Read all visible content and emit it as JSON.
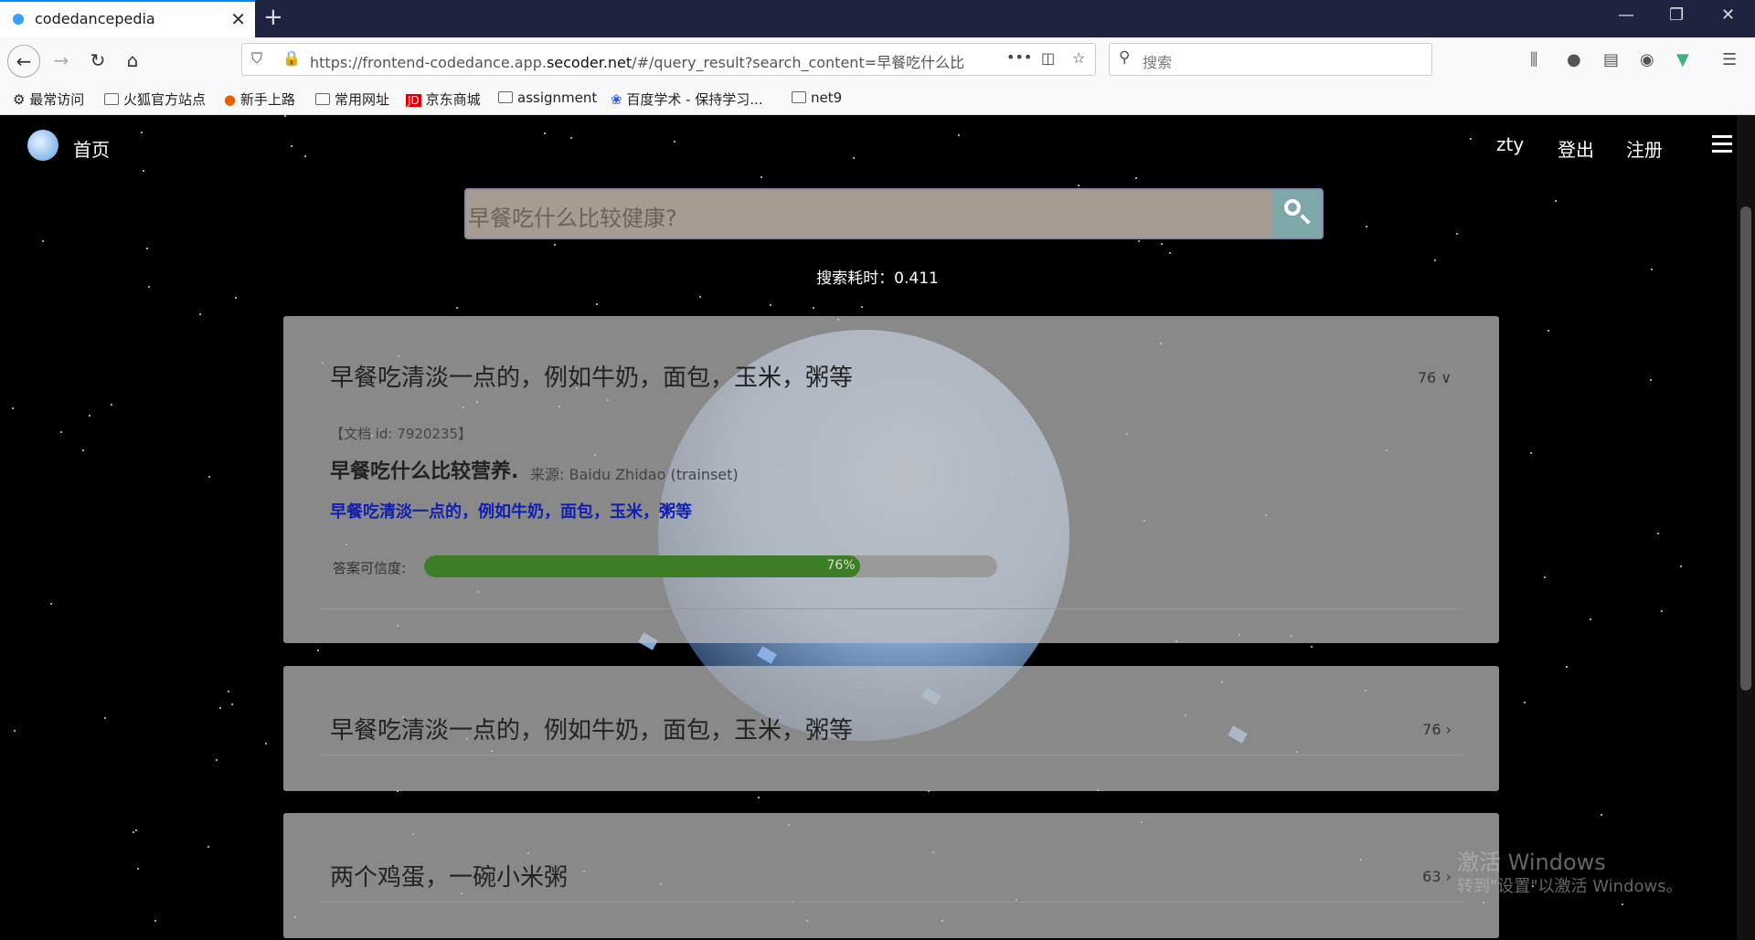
{
  "browser": {
    "tab_title": "codedancepedia",
    "url_prefix": "https://frontend-codedance.app.",
    "url_host": "secoder.net",
    "url_suffix": "/#/query_result?search_content=早餐吃什么比",
    "search_placeholder": "搜索",
    "url_more": "•••"
  },
  "bookmarks": [
    "最常访问",
    "火狐官方站点",
    "新手上路",
    "常用网址",
    "京东商城",
    "assignment",
    "百度学术 - 保持学习...",
    "net9"
  ],
  "header": {
    "home": "首页",
    "user": "zty",
    "logout": "登出",
    "register": "注册"
  },
  "search": {
    "query": "早餐吃什么比较健康?"
  },
  "timing": "搜索耗时：0.411",
  "results": [
    {
      "title": "早餐吃清淡一点的，例如牛奶，面包，玉米，粥等",
      "score": "76",
      "chev": "∨",
      "doc_id": "【文档 id: 7920235】",
      "question": "早餐吃什么比较营养.",
      "source": "来源:  Baidu Zhidao (trainset)",
      "answer": "早餐吃清淡一点的，例如牛奶，面包，玉米，粥等",
      "confidence_label": "答案可信度:",
      "confidence": 76,
      "confidence_text": "76%"
    },
    {
      "title": "早餐吃清淡一点的，例如牛奶，面包，玉米，粥等",
      "score": "76",
      "chev": "›"
    },
    {
      "title": "两个鸡蛋，一碗小米粥",
      "score": "63",
      "chev": "›"
    }
  ],
  "watermark": {
    "line1": "激活 Windows",
    "line2": "转到\"设置\"以激活 Windows。"
  }
}
